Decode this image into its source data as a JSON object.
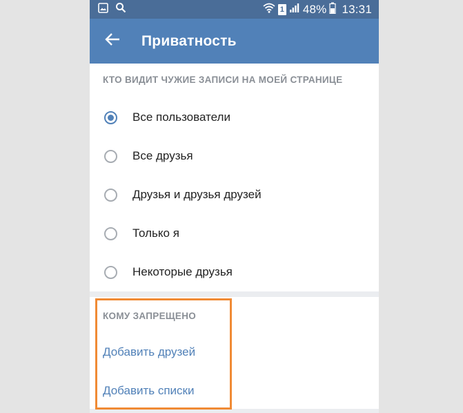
{
  "status_bar": {
    "battery": "48%",
    "time": "13:31",
    "sim_badge": "1",
    "icons": [
      "image-icon",
      "search-icon",
      "wifi-icon",
      "sim-icon",
      "signal-icon",
      "battery-icon"
    ]
  },
  "toolbar": {
    "title": "Приватность",
    "back_icon": "arrow-left-icon"
  },
  "section_who_sees": {
    "header": "КТО ВИДИТ ЧУЖИЕ ЗАПИСИ НА МОЕЙ СТРАНИЦЕ",
    "options": [
      {
        "label": "Все пользователи",
        "checked": true
      },
      {
        "label": "Все друзья",
        "checked": false
      },
      {
        "label": "Друзья и друзья друзей",
        "checked": false
      },
      {
        "label": "Только я",
        "checked": false
      },
      {
        "label": "Некоторые друзья",
        "checked": false
      }
    ]
  },
  "section_forbidden": {
    "header": "КОМУ ЗАПРЕЩЕНО",
    "links": [
      "Добавить друзей",
      "Добавить списки"
    ]
  },
  "colors": {
    "accent": "#5181b8",
    "status_bar": "#4a6d98",
    "highlight": "#f08a34",
    "header_text": "#8a8f96"
  }
}
